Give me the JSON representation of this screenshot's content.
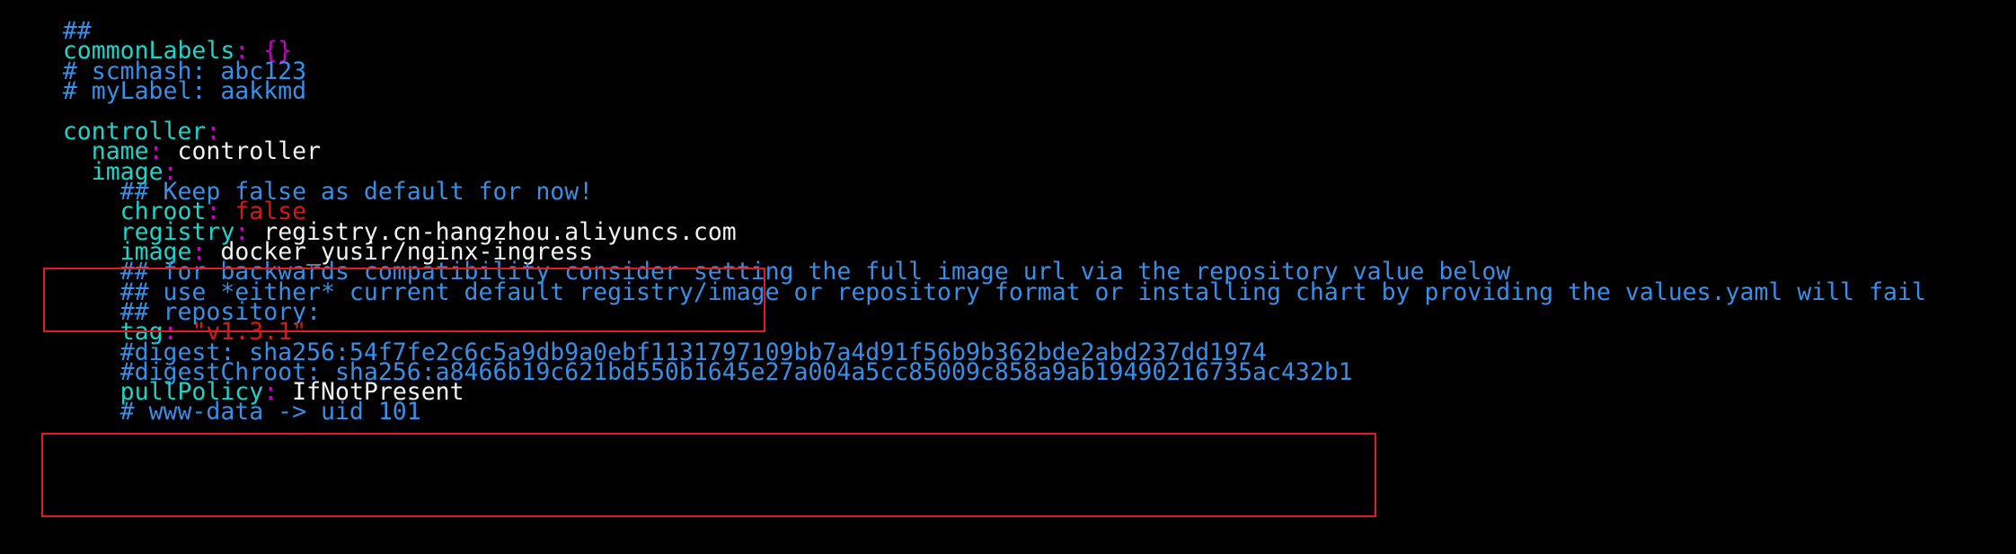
{
  "theme": {
    "background": "#000000",
    "key_color": "#1fd3c8",
    "punct_color": "#c800c8",
    "comment_color": "#3a8ee6",
    "value_color": "#f2f2f2",
    "string_color": "#d11a1a",
    "highlight_box_color": "#e01b24"
  },
  "lines": {
    "l0": "##",
    "l1_key": "commonLabels",
    "l1_colon": ":",
    "l1_val": "{}",
    "l2": "# scmhash: abc123",
    "l3": "# myLabel: aakkmd",
    "l5_key": "controller",
    "l5_colon": ":",
    "l6_key": "name",
    "l6_colon": ":",
    "l6_val": "controller",
    "l7_key": "image",
    "l7_colon": ":",
    "l8": "## Keep false as default for now!",
    "l9_key": "chroot",
    "l9_colon": ":",
    "l9_val": "false",
    "l10_key": "registry",
    "l10_colon": ":",
    "l10_val": "registry.cn-hangzhou.aliyuncs.com",
    "l11_key": "image",
    "l11_colon": ":",
    "l11_val": "docker_yusir/nginx-ingress",
    "l12": "## for backwards compatibility consider setting the full image url via the repository value below",
    "l13": "## use *either* current default registry/image or repository format or installing chart by providing the values.yaml will fail",
    "l14": "## repository:",
    "l15_key": "tag",
    "l15_colon": ":",
    "l15_val": "\"v1.3.1\"",
    "l16": "#digest: sha256:54f7fe2c6c5a9db9a0ebf1131797109bb7a4d91f56b9b362bde2abd237dd1974",
    "l17": "#digestChroot: sha256:a8466b19c621bd550b1645e27a004a5cc85009c858a9ab19490216735ac432b1",
    "l18_key": "pullPolicy",
    "l18_colon": ":",
    "l18_val": "IfNotPresent",
    "l19": "# www-data -> uid 101"
  }
}
